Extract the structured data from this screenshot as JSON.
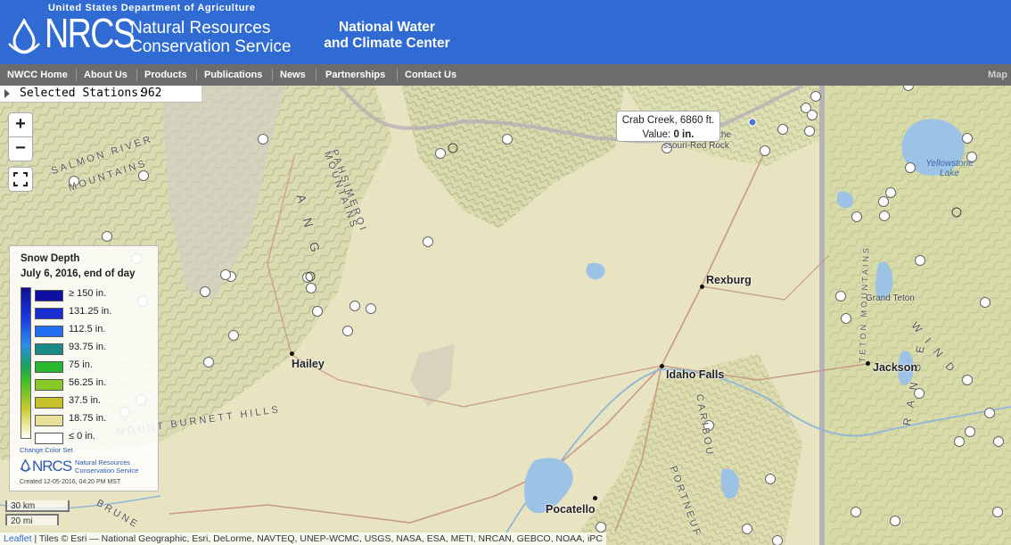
{
  "header": {
    "usda": "United States Department of Agriculture",
    "logo_nrcs": "NRCS",
    "logo_line1": "Natural Resources",
    "logo_line2": "Conservation Service",
    "center_title_line1": "National Water",
    "center_title_line2": "and Climate Center",
    "brand_color": "#2f6bd3"
  },
  "nav": {
    "items": [
      {
        "label": "NWCC Home"
      },
      {
        "label": "About Us"
      },
      {
        "label": "Products"
      },
      {
        "label": "Publications"
      },
      {
        "label": "News"
      },
      {
        "label": "Partnerships"
      },
      {
        "label": "Contact Us"
      }
    ],
    "right_label": "Map"
  },
  "selected": {
    "label": "Selected Stations:",
    "count": "962"
  },
  "zoom": {
    "in": "+",
    "out": "−"
  },
  "legend": {
    "title1": "Snow Depth",
    "title2": "July 6, 2016, end of day",
    "items": [
      {
        "label": "≥ 150 in.",
        "color": "#1010a0"
      },
      {
        "label": "131.25 in.",
        "color": "#1a2ed0"
      },
      {
        "label": "112.5 in.",
        "color": "#2070f0"
      },
      {
        "label": "93.75 in.",
        "color": "#1a8a88"
      },
      {
        "label": "75 in.",
        "color": "#2ab830"
      },
      {
        "label": "56.25 in.",
        "color": "#88c828"
      },
      {
        "label": "37.5 in.",
        "color": "#c8c028"
      },
      {
        "label": "18.75 in.",
        "color": "#e8e098"
      },
      {
        "label": "≤ 0 in.",
        "color": "#ffffff"
      }
    ],
    "change_color": "Change Color Set",
    "logo_nrcs": "NRCS",
    "logo_line1": "Natural Resources",
    "logo_line2": "Conservation Service",
    "created": "Created 12-05-2016, 04:20 PM MST"
  },
  "scale": {
    "km": "30 km",
    "mi": "20 mi"
  },
  "attribution": {
    "leaflet": "Leaflet",
    "tiles": " | Tiles © Esri — National Geographic, Esri, DeLorme, NAVTEQ, UNEP-WCMC, USGS, NASA, ESA, METI, NRCAN, GEBCO, NOAA, iPC"
  },
  "tooltip": {
    "line1": "Crab Creek, 6860 ft.",
    "value_label": "Value:",
    "value": "0 in."
  },
  "cities": {
    "hailey": "Hailey",
    "idaho_falls": "Idaho Falls",
    "rexburg": "Rexburg",
    "pocatello": "Pocatello",
    "jackson": "Jackson"
  },
  "features": {
    "grand_teton": "Grand Teton",
    "yellowstone_lake": "Yellowstone Lake",
    "salmon_river": "SALMON RIVER",
    "mountains": "MOUNTAINS",
    "pahsimeroi": "PAHSIMEROI",
    "pahsimeroi_mountains": "MOUNTAINS",
    "mount_burnett_hills": "MOUNT BURNETT HILLS",
    "caribou": "CARIBOU",
    "portneuf": "PORTNEUF",
    "wind": "WIND",
    "range": "RANGE",
    "teton_mountains": "TETON MOUNTAINS",
    "lemhi_partial": "ANG",
    "centennial_partial": "of the",
    "red_rock_partial": "ssouri-Red Rock",
    "bruneau_partial": "BRUNE"
  }
}
